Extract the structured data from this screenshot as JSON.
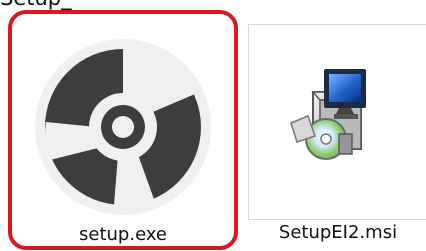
{
  "top_text": "Setup_",
  "files": [
    {
      "name": "setup.exe",
      "icon": "disc-icon",
      "selected": true
    },
    {
      "name": "SetupEI2.msi",
      "icon": "installer-package-icon",
      "selected": false
    }
  ],
  "colors": {
    "selection_border": "#d71920",
    "disc_dark": "#3d3d3d",
    "disc_light": "#f0f0f0",
    "installer_blue": "#1f62c8",
    "installer_green": "#6ac34a"
  }
}
